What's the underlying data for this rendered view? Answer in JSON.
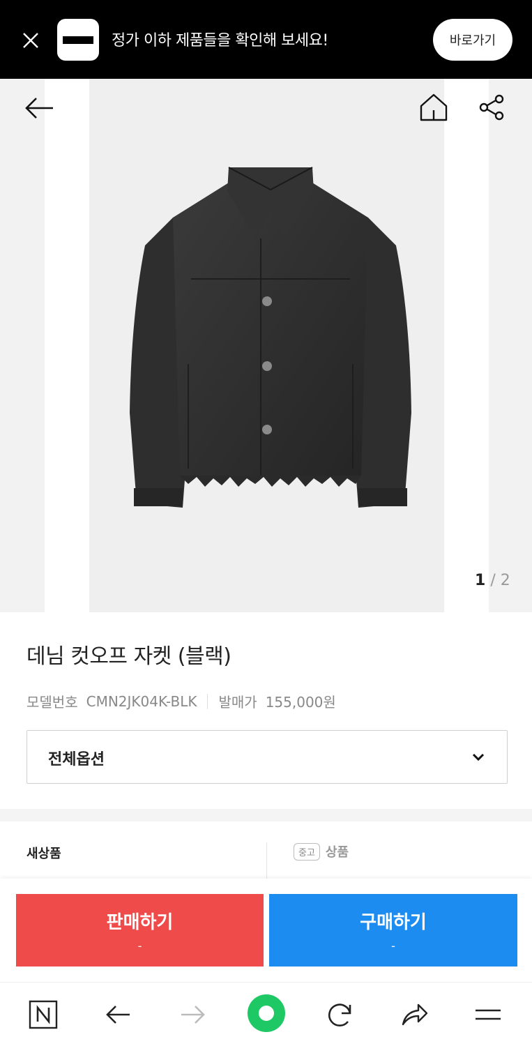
{
  "banner": {
    "message": "정가 이하 제품들을 확인해 보세요!",
    "cta_label": "바로가기"
  },
  "gallery": {
    "current": "1",
    "separator": "/",
    "total": "2"
  },
  "product": {
    "title": "데님 컷오프 자켓 (블랙)",
    "model_label": "모델번호",
    "model_value": "CMN2JK04K-BLK",
    "release_label": "발매가",
    "release_value": "155,000원"
  },
  "option_select": {
    "label": "전체옵션"
  },
  "condition_tabs": {
    "new_label": "새상품",
    "used_chip": "중고",
    "used_label": "상품"
  },
  "actions": {
    "sell_label": "판매하기",
    "sell_price": "-",
    "buy_label": "구매하기",
    "buy_price": "-"
  },
  "colors": {
    "sell": "#ef4b4b",
    "buy": "#1d8cf0",
    "browser_green": "#1ec864"
  }
}
